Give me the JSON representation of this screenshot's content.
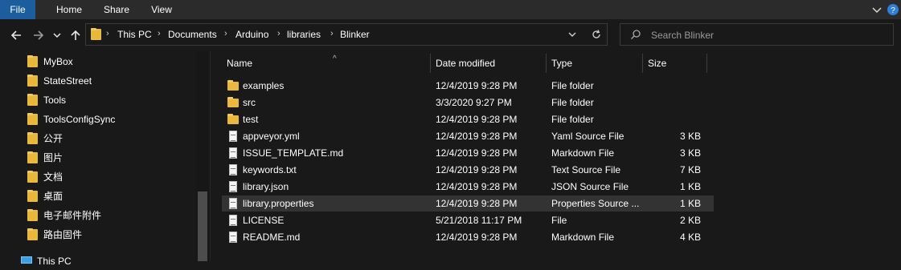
{
  "ribbon": {
    "tabs": [
      "File",
      "Home",
      "Share",
      "View"
    ],
    "collapse_icon": "chevron-down-icon",
    "help_icon": "help-icon"
  },
  "nav": {
    "back_icon": "arrow-left-icon",
    "forward_icon": "arrow-right-icon",
    "recent_icon": "chevron-down-icon",
    "up_icon": "arrow-up-icon"
  },
  "address": {
    "crumbs": [
      "This PC",
      "Documents",
      "Arduino",
      "libraries",
      "Blinker"
    ],
    "dropdown_icon": "chevron-down-icon",
    "refresh_icon": "refresh-icon"
  },
  "search": {
    "placeholder": "Search Blinker",
    "icon": "search-icon"
  },
  "sidebar": {
    "items": [
      {
        "label": "MyBox",
        "icon": "folder-icon"
      },
      {
        "label": "StateStreet",
        "icon": "folder-icon"
      },
      {
        "label": "Tools",
        "icon": "folder-icon"
      },
      {
        "label": "ToolsConfigSync",
        "icon": "folder-icon"
      },
      {
        "label": "公开",
        "icon": "folder-icon"
      },
      {
        "label": "图片",
        "icon": "folder-icon"
      },
      {
        "label": "文档",
        "icon": "folder-icon"
      },
      {
        "label": "桌面",
        "icon": "folder-icon"
      },
      {
        "label": "电子邮件附件",
        "icon": "folder-icon"
      },
      {
        "label": "路由固件",
        "icon": "folder-icon"
      },
      {
        "label": "This PC",
        "icon": "computer-icon"
      }
    ]
  },
  "columns": {
    "name": "Name",
    "date": "Date modified",
    "type": "Type",
    "size": "Size"
  },
  "files": [
    {
      "name": "examples",
      "date": "12/4/2019 9:28 PM",
      "type": "File folder",
      "size": "",
      "icon": "folder-icon"
    },
    {
      "name": "src",
      "date": "3/3/2020 9:27 PM",
      "type": "File folder",
      "size": "",
      "icon": "folder-icon"
    },
    {
      "name": "test",
      "date": "12/4/2019 9:28 PM",
      "type": "File folder",
      "size": "",
      "icon": "folder-icon"
    },
    {
      "name": "appveyor.yml",
      "date": "12/4/2019 9:28 PM",
      "type": "Yaml Source File",
      "size": "3 KB",
      "icon": "file-icon"
    },
    {
      "name": "ISSUE_TEMPLATE.md",
      "date": "12/4/2019 9:28 PM",
      "type": "Markdown File",
      "size": "3 KB",
      "icon": "file-icon"
    },
    {
      "name": "keywords.txt",
      "date": "12/4/2019 9:28 PM",
      "type": "Text Source File",
      "size": "7 KB",
      "icon": "file-icon"
    },
    {
      "name": "library.json",
      "date": "12/4/2019 9:28 PM",
      "type": "JSON Source File",
      "size": "1 KB",
      "icon": "file-icon"
    },
    {
      "name": "library.properties",
      "date": "12/4/2019 9:28 PM",
      "type": "Properties Source ...",
      "size": "1 KB",
      "icon": "file-icon"
    },
    {
      "name": "LICENSE",
      "date": "5/21/2018 11:17 PM",
      "type": "File",
      "size": "2 KB",
      "icon": "file-icon"
    },
    {
      "name": "README.md",
      "date": "12/4/2019 9:28 PM",
      "type": "Markdown File",
      "size": "4 KB",
      "icon": "file-icon"
    }
  ],
  "colors": {
    "background": "#191919",
    "ribbon": "#2b2b2b",
    "file_tab": "#1c5d9e",
    "folder": "#e8b93c",
    "selected_row": "#333333"
  }
}
